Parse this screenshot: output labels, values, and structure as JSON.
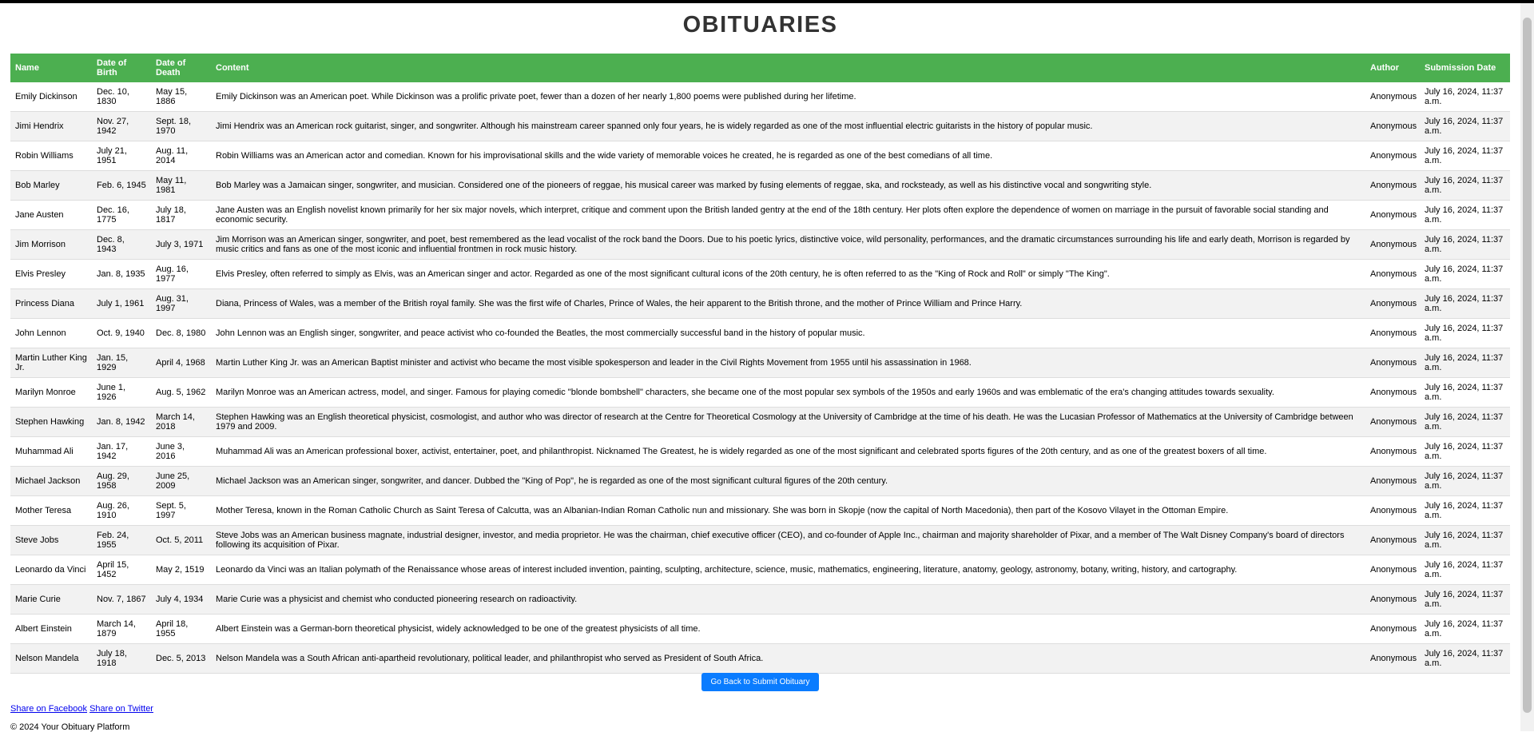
{
  "page": {
    "title": "OBITUARIES"
  },
  "table": {
    "headers": [
      "Name",
      "Date of Birth",
      "Date of Death",
      "Content",
      "Author",
      "Submission Date"
    ],
    "rows": [
      {
        "name": "Emily Dickinson",
        "dob": "Dec. 10, 1830",
        "dod": "May 15, 1886",
        "content": "Emily Dickinson was an American poet. While Dickinson was a prolific private poet, fewer than a dozen of her nearly 1,800 poems were published during her lifetime.",
        "author": "Anonymous",
        "submitted": "July 16, 2024, 11:37 a.m."
      },
      {
        "name": "Jimi Hendrix",
        "dob": "Nov. 27, 1942",
        "dod": "Sept. 18, 1970",
        "content": "Jimi Hendrix was an American rock guitarist, singer, and songwriter. Although his mainstream career spanned only four years, he is widely regarded as one of the most influential electric guitarists in the history of popular music.",
        "author": "Anonymous",
        "submitted": "July 16, 2024, 11:37 a.m."
      },
      {
        "name": "Robin Williams",
        "dob": "July 21, 1951",
        "dod": "Aug. 11, 2014",
        "content": "Robin Williams was an American actor and comedian. Known for his improvisational skills and the wide variety of memorable voices he created, he is regarded as one of the best comedians of all time.",
        "author": "Anonymous",
        "submitted": "July 16, 2024, 11:37 a.m."
      },
      {
        "name": "Bob Marley",
        "dob": "Feb. 6, 1945",
        "dod": "May 11, 1981",
        "content": "Bob Marley was a Jamaican singer, songwriter, and musician. Considered one of the pioneers of reggae, his musical career was marked by fusing elements of reggae, ska, and rocksteady, as well as his distinctive vocal and songwriting style.",
        "author": "Anonymous",
        "submitted": "July 16, 2024, 11:37 a.m."
      },
      {
        "name": "Jane Austen",
        "dob": "Dec. 16, 1775",
        "dod": "July 18, 1817",
        "content": "Jane Austen was an English novelist known primarily for her six major novels, which interpret, critique and comment upon the British landed gentry at the end of the 18th century. Her plots often explore the dependence of women on marriage in the pursuit of favorable social standing and economic security.",
        "author": "Anonymous",
        "submitted": "July 16, 2024, 11:37 a.m."
      },
      {
        "name": "Jim Morrison",
        "dob": "Dec. 8, 1943",
        "dod": "July 3, 1971",
        "content": "Jim Morrison was an American singer, songwriter, and poet, best remembered as the lead vocalist of the rock band the Doors. Due to his poetic lyrics, distinctive voice, wild personality, performances, and the dramatic circumstances surrounding his life and early death, Morrison is regarded by music critics and fans as one of the most iconic and influential frontmen in rock music history.",
        "author": "Anonymous",
        "submitted": "July 16, 2024, 11:37 a.m."
      },
      {
        "name": "Elvis Presley",
        "dob": "Jan. 8, 1935",
        "dod": "Aug. 16, 1977",
        "content": "Elvis Presley, often referred to simply as Elvis, was an American singer and actor. Regarded as one of the most significant cultural icons of the 20th century, he is often referred to as the \"King of Rock and Roll\" or simply \"The King\".",
        "author": "Anonymous",
        "submitted": "July 16, 2024, 11:37 a.m."
      },
      {
        "name": "Princess Diana",
        "dob": "July 1, 1961",
        "dod": "Aug. 31, 1997",
        "content": "Diana, Princess of Wales, was a member of the British royal family. She was the first wife of Charles, Prince of Wales, the heir apparent to the British throne, and the mother of Prince William and Prince Harry.",
        "author": "Anonymous",
        "submitted": "July 16, 2024, 11:37 a.m."
      },
      {
        "name": "John Lennon",
        "dob": "Oct. 9, 1940",
        "dod": "Dec. 8, 1980",
        "content": "John Lennon was an English singer, songwriter, and peace activist who co-founded the Beatles, the most commercially successful band in the history of popular music.",
        "author": "Anonymous",
        "submitted": "July 16, 2024, 11:37 a.m."
      },
      {
        "name": "Martin Luther King Jr.",
        "dob": "Jan. 15, 1929",
        "dod": "April 4, 1968",
        "content": "Martin Luther King Jr. was an American Baptist minister and activist who became the most visible spokesperson and leader in the Civil Rights Movement from 1955 until his assassination in 1968.",
        "author": "Anonymous",
        "submitted": "July 16, 2024, 11:37 a.m."
      },
      {
        "name": "Marilyn Monroe",
        "dob": "June 1, 1926",
        "dod": "Aug. 5, 1962",
        "content": "Marilyn Monroe was an American actress, model, and singer. Famous for playing comedic \"blonde bombshell\" characters, she became one of the most popular sex symbols of the 1950s and early 1960s and was emblematic of the era's changing attitudes towards sexuality.",
        "author": "Anonymous",
        "submitted": "July 16, 2024, 11:37 a.m."
      },
      {
        "name": "Stephen Hawking",
        "dob": "Jan. 8, 1942",
        "dod": "March 14, 2018",
        "content": "Stephen Hawking was an English theoretical physicist, cosmologist, and author who was director of research at the Centre for Theoretical Cosmology at the University of Cambridge at the time of his death. He was the Lucasian Professor of Mathematics at the University of Cambridge between 1979 and 2009.",
        "author": "Anonymous",
        "submitted": "July 16, 2024, 11:37 a.m."
      },
      {
        "name": "Muhammad Ali",
        "dob": "Jan. 17, 1942",
        "dod": "June 3, 2016",
        "content": "Muhammad Ali was an American professional boxer, activist, entertainer, poet, and philanthropist. Nicknamed The Greatest, he is widely regarded as one of the most significant and celebrated sports figures of the 20th century, and as one of the greatest boxers of all time.",
        "author": "Anonymous",
        "submitted": "July 16, 2024, 11:37 a.m."
      },
      {
        "name": "Michael Jackson",
        "dob": "Aug. 29, 1958",
        "dod": "June 25, 2009",
        "content": "Michael Jackson was an American singer, songwriter, and dancer. Dubbed the \"King of Pop\", he is regarded as one of the most significant cultural figures of the 20th century.",
        "author": "Anonymous",
        "submitted": "July 16, 2024, 11:37 a.m."
      },
      {
        "name": "Mother Teresa",
        "dob": "Aug. 26, 1910",
        "dod": "Sept. 5, 1997",
        "content": "Mother Teresa, known in the Roman Catholic Church as Saint Teresa of Calcutta, was an Albanian-Indian Roman Catholic nun and missionary. She was born in Skopje (now the capital of North Macedonia), then part of the Kosovo Vilayet in the Ottoman Empire.",
        "author": "Anonymous",
        "submitted": "July 16, 2024, 11:37 a.m."
      },
      {
        "name": "Steve Jobs",
        "dob": "Feb. 24, 1955",
        "dod": "Oct. 5, 2011",
        "content": "Steve Jobs was an American business magnate, industrial designer, investor, and media proprietor. He was the chairman, chief executive officer (CEO), and co-founder of Apple Inc., chairman and majority shareholder of Pixar, and a member of The Walt Disney Company's board of directors following its acquisition of Pixar.",
        "author": "Anonymous",
        "submitted": "July 16, 2024, 11:37 a.m."
      },
      {
        "name": "Leonardo da Vinci",
        "dob": "April 15, 1452",
        "dod": "May 2, 1519",
        "content": "Leonardo da Vinci was an Italian polymath of the Renaissance whose areas of interest included invention, painting, sculpting, architecture, science, music, mathematics, engineering, literature, anatomy, geology, astronomy, botany, writing, history, and cartography.",
        "author": "Anonymous",
        "submitted": "July 16, 2024, 11:37 a.m."
      },
      {
        "name": "Marie Curie",
        "dob": "Nov. 7, 1867",
        "dod": "July 4, 1934",
        "content": "Marie Curie was a physicist and chemist who conducted pioneering research on radioactivity.",
        "author": "Anonymous",
        "submitted": "July 16, 2024, 11:37 a.m."
      },
      {
        "name": "Albert Einstein",
        "dob": "March 14, 1879",
        "dod": "April 18, 1955",
        "content": "Albert Einstein was a German-born theoretical physicist, widely acknowledged to be one of the greatest physicists of all time.",
        "author": "Anonymous",
        "submitted": "July 16, 2024, 11:37 a.m."
      },
      {
        "name": "Nelson Mandela",
        "dob": "July 18, 1918",
        "dod": "Dec. 5, 2013",
        "content": "Nelson Mandela was a South African anti-apartheid revolutionary, political leader, and philanthropist who served as President of South Africa.",
        "author": "Anonymous",
        "submitted": "July 16, 2024, 11:37 a.m."
      }
    ]
  },
  "actions": {
    "back_button": "Go Back to Submit Obituary"
  },
  "share": {
    "facebook": "Share on Facebook",
    "twitter": "Share on Twitter"
  },
  "footer": {
    "copyright": "© 2024 Your Obituary Platform"
  },
  "colors": {
    "header_bg": "#4caf50",
    "button_bg": "#0a7cff",
    "stripe_bg": "#f2f2f2"
  }
}
